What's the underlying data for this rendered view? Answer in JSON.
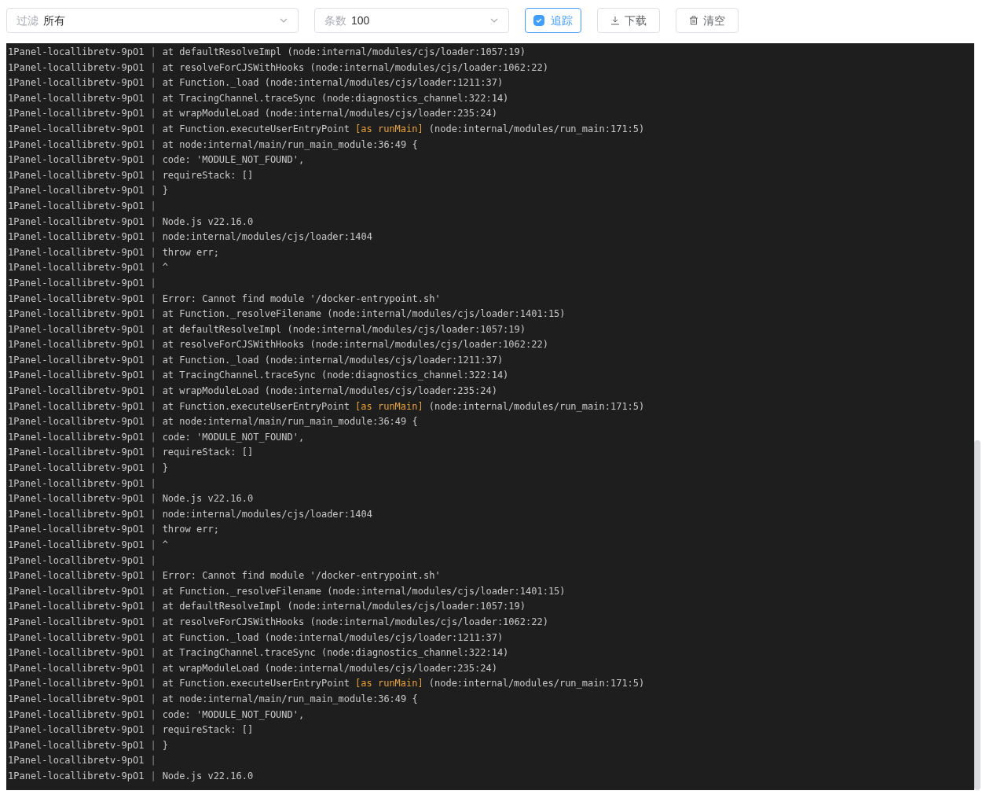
{
  "toolbar": {
    "filter": {
      "label": "过滤",
      "value": "所有"
    },
    "count": {
      "label": "条数",
      "value": "100"
    },
    "follow": {
      "label": "追踪",
      "checked": true
    },
    "download": {
      "label": "下载"
    },
    "clear": {
      "label": "清空"
    }
  },
  "log": {
    "lines": [
      {
        "container": "1Panel-locallibretv-9pO1",
        "separator": "|",
        "message": "at defaultResolveImpl (node:internal/modules/cjs/loader:1057:19)"
      },
      {
        "container": "1Panel-locallibretv-9pO1",
        "separator": "|",
        "message": "at resolveForCJSWithHooks (node:internal/modules/cjs/loader:1062:22)"
      },
      {
        "container": "1Panel-locallibretv-9pO1",
        "separator": "|",
        "message": "at Function._load (node:internal/modules/cjs/loader:1211:37)"
      },
      {
        "container": "1Panel-locallibretv-9pO1",
        "separator": "|",
        "message": "at TracingChannel.traceSync (node:diagnostics_channel:322:14)"
      },
      {
        "container": "1Panel-locallibretv-9pO1",
        "separator": "|",
        "message": "at wrapModuleLoad (node:internal/modules/cjs/loader:235:24)"
      },
      {
        "container": "1Panel-locallibretv-9pO1",
        "separator": "|",
        "message": "at Function.executeUserEntryPoint",
        "tag": "[as runMain]",
        "rest": "(node:internal/modules/run_main:171:5)"
      },
      {
        "container": "1Panel-locallibretv-9pO1",
        "separator": "|",
        "message": "at node:internal/main/run_main_module:36:49 {"
      },
      {
        "container": "1Panel-locallibretv-9pO1",
        "separator": "|",
        "message": "code: 'MODULE_NOT_FOUND',"
      },
      {
        "container": "1Panel-locallibretv-9pO1",
        "separator": "|",
        "message": "requireStack: []"
      },
      {
        "container": "1Panel-locallibretv-9pO1",
        "separator": "|",
        "message": "}"
      },
      {
        "container": "1Panel-locallibretv-9pO1",
        "separator": "|"
      },
      {
        "container": "1Panel-locallibretv-9pO1",
        "separator": "|",
        "message": "Node.js v22.16.0"
      },
      {
        "container": "1Panel-locallibretv-9pO1",
        "separator": "|",
        "message": "node:internal/modules/cjs/loader:1404"
      },
      {
        "container": "1Panel-locallibretv-9pO1",
        "separator": "|",
        "message": "throw err;"
      },
      {
        "container": "1Panel-locallibretv-9pO1",
        "separator": "|",
        "message": "^"
      },
      {
        "container": "1Panel-locallibretv-9pO1",
        "separator": "|"
      },
      {
        "container": "1Panel-locallibretv-9pO1",
        "separator": "|",
        "message": "Error: Cannot find module '/docker-entrypoint.sh'"
      },
      {
        "container": "1Panel-locallibretv-9pO1",
        "separator": "|",
        "message": "at Function._resolveFilename (node:internal/modules/cjs/loader:1401:15)"
      },
      {
        "container": "1Panel-locallibretv-9pO1",
        "separator": "|",
        "message": "at defaultResolveImpl (node:internal/modules/cjs/loader:1057:19)"
      },
      {
        "container": "1Panel-locallibretv-9pO1",
        "separator": "|",
        "message": "at resolveForCJSWithHooks (node:internal/modules/cjs/loader:1062:22)"
      },
      {
        "container": "1Panel-locallibretv-9pO1",
        "separator": "|",
        "message": "at Function._load (node:internal/modules/cjs/loader:1211:37)"
      },
      {
        "container": "1Panel-locallibretv-9pO1",
        "separator": "|",
        "message": "at TracingChannel.traceSync (node:diagnostics_channel:322:14)"
      },
      {
        "container": "1Panel-locallibretv-9pO1",
        "separator": "|",
        "message": "at wrapModuleLoad (node:internal/modules/cjs/loader:235:24)"
      },
      {
        "container": "1Panel-locallibretv-9pO1",
        "separator": "|",
        "message": "at Function.executeUserEntryPoint",
        "tag": "[as runMain]",
        "rest": "(node:internal/modules/run_main:171:5)"
      },
      {
        "container": "1Panel-locallibretv-9pO1",
        "separator": "|",
        "message": "at node:internal/main/run_main_module:36:49 {"
      },
      {
        "container": "1Panel-locallibretv-9pO1",
        "separator": "|",
        "message": "code: 'MODULE_NOT_FOUND',"
      },
      {
        "container": "1Panel-locallibretv-9pO1",
        "separator": "|",
        "message": "requireStack: []"
      },
      {
        "container": "1Panel-locallibretv-9pO1",
        "separator": "|",
        "message": "}"
      },
      {
        "container": "1Panel-locallibretv-9pO1",
        "separator": "|"
      },
      {
        "container": "1Panel-locallibretv-9pO1",
        "separator": "|",
        "message": "Node.js v22.16.0"
      },
      {
        "container": "1Panel-locallibretv-9pO1",
        "separator": "|",
        "message": "node:internal/modules/cjs/loader:1404"
      },
      {
        "container": "1Panel-locallibretv-9pO1",
        "separator": "|",
        "message": "throw err;"
      },
      {
        "container": "1Panel-locallibretv-9pO1",
        "separator": "|",
        "message": "^"
      },
      {
        "container": "1Panel-locallibretv-9pO1",
        "separator": "|"
      },
      {
        "container": "1Panel-locallibretv-9pO1",
        "separator": "|",
        "message": "Error: Cannot find module '/docker-entrypoint.sh'"
      },
      {
        "container": "1Panel-locallibretv-9pO1",
        "separator": "|",
        "message": "at Function._resolveFilename (node:internal/modules/cjs/loader:1401:15)"
      },
      {
        "container": "1Panel-locallibretv-9pO1",
        "separator": "|",
        "message": "at defaultResolveImpl (node:internal/modules/cjs/loader:1057:19)"
      },
      {
        "container": "1Panel-locallibretv-9pO1",
        "separator": "|",
        "message": "at resolveForCJSWithHooks (node:internal/modules/cjs/loader:1062:22)"
      },
      {
        "container": "1Panel-locallibretv-9pO1",
        "separator": "|",
        "message": "at Function._load (node:internal/modules/cjs/loader:1211:37)"
      },
      {
        "container": "1Panel-locallibretv-9pO1",
        "separator": "|",
        "message": "at TracingChannel.traceSync (node:diagnostics_channel:322:14)"
      },
      {
        "container": "1Panel-locallibretv-9pO1",
        "separator": "|",
        "message": "at wrapModuleLoad (node:internal/modules/cjs/loader:235:24)"
      },
      {
        "container": "1Panel-locallibretv-9pO1",
        "separator": "|",
        "message": "at Function.executeUserEntryPoint",
        "tag": "[as runMain]",
        "rest": "(node:internal/modules/run_main:171:5)"
      },
      {
        "container": "1Panel-locallibretv-9pO1",
        "separator": "|",
        "message": "at node:internal/main/run_main_module:36:49 {"
      },
      {
        "container": "1Panel-locallibretv-9pO1",
        "separator": "|",
        "message": "code: 'MODULE_NOT_FOUND',"
      },
      {
        "container": "1Panel-locallibretv-9pO1",
        "separator": "|",
        "message": "requireStack: []"
      },
      {
        "container": "1Panel-locallibretv-9pO1",
        "separator": "|",
        "message": "}"
      },
      {
        "container": "1Panel-locallibretv-9pO1",
        "separator": "|"
      },
      {
        "container": "1Panel-locallibretv-9pO1",
        "separator": "|",
        "message": "Node.js v22.16.0"
      }
    ]
  }
}
